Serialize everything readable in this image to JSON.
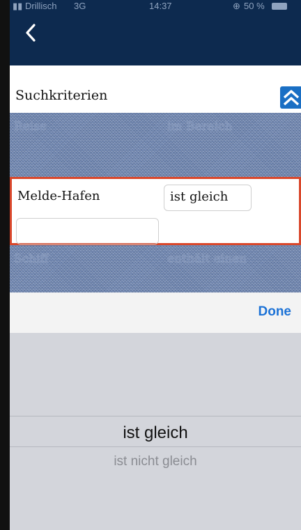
{
  "status_bar": {
    "carrier": "Drillisch",
    "network": "3G",
    "time": "14:37",
    "battery": "50 %"
  },
  "nav": {
    "back_icon": "chevron-left-icon",
    "back_glyph": "‹"
  },
  "section": {
    "title": "Suchkriterien",
    "collapse_icon": "double-chevron-up-icon"
  },
  "filters": [
    {
      "label": "Reise",
      "operator": "im Bereich"
    },
    {
      "label": "Melde-Hafen",
      "operator": "ist gleich",
      "value": ""
    },
    {
      "label": "Schiff",
      "operator": "enthält einen"
    }
  ],
  "picker": {
    "done_label": "Done",
    "options": [
      "ist gleich",
      "ist nicht gleich"
    ],
    "selected": "ist gleich"
  },
  "colors": {
    "nav_bg": "#0d2a4f",
    "highlight_border": "#d9472b",
    "accent": "#1a6fc4",
    "done": "#1c72d6"
  }
}
